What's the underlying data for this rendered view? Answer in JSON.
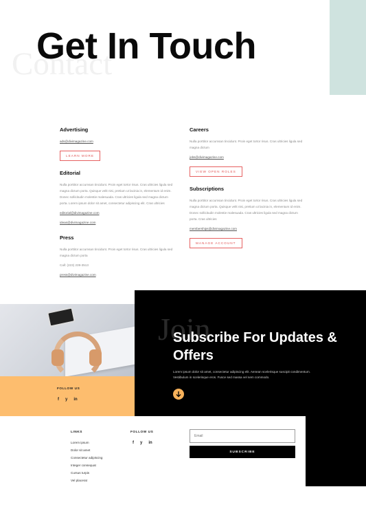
{
  "hero": {
    "title": "Get In Touch",
    "bg_word": "Contact"
  },
  "contact": {
    "advertising": {
      "heading": "Advertising",
      "email": "ads@divimagazine.com",
      "button": "LEARN MORE"
    },
    "editorial": {
      "heading": "Editorial",
      "text": "Nulla porttitor accumsan tincidunt. Proin eget tortor risus. Cras ultricies ligula sed magna dictum porta. Quisque velit nisi, pretium ut lacinia in, elementum id enim. Donec sollicitudin molestie malesuada. Cras ultricies ligula sed magna dictum porta. Lorem ipsum dolor sit amet, consectetur adipiscing elit. Cras ultricies",
      "email1": "editorial@divimagazine.com",
      "email2": "ideas@divimagazine.com"
    },
    "press": {
      "heading": "Press",
      "text": "Nulla porttitor accumsan tincidunt. Proin eget tortor risus. Cras ultricies ligula sed magna dictum porta",
      "phone": "Call: (223) 239-3513",
      "email": "press@divimagazine.com"
    },
    "careers": {
      "heading": "Careers",
      "text": "Nulla porttitor accumsan tincidunt. Proin eget tortor risus. Cras ultricies ligula sed magna dictum",
      "email": "jobs@divimagazine.com",
      "button": "VIEW OPEN ROLES"
    },
    "subscriptions": {
      "heading": "Subscriptions",
      "text": "Nulla porttitor accumsan tincidunt. Proin eget tortor risus. Cras ultricies ligula sed magna dictum porta. Quisque velit nisi, pretium ut lacinia in, elementum id enim. Donec sollicitudin molestie malesuada. Cras ultricies ligula sed magna dictum porta. Cras ultricies",
      "email": "memberships@divimagazine.com",
      "button": "MANAGE ACCOUNT"
    }
  },
  "subscribe": {
    "bg_word": "Join",
    "title": "Subscribe For Updates & Offers",
    "text": "Lorem ipsum dolor sit amet, consectetur adipiscing elit. Aenean scelerisque suscipit condimentum. Vestibulum in scelerisque eros. Fusce sed massa vel sem commodo.",
    "arrow_icon": "arrow-down-circle-icon"
  },
  "follow": {
    "label": "FOLLOW US",
    "icons": [
      "facebook-icon",
      "twitter-icon",
      "linkedin-icon"
    ],
    "glyphs": [
      "f",
      "y",
      "in"
    ]
  },
  "footer": {
    "links_label": "LINKS",
    "links": [
      "Lorem ipsum",
      "Dolor sit amet",
      "Consectetur adipiscing",
      "Integer consequat",
      "Cursus turpis",
      "Vel placerat"
    ],
    "follow_label": "FOLLOW US",
    "email_placeholder": "Email",
    "subscribe_button": "SUBSCRIBE"
  },
  "colors": {
    "accent_teal": "#cfe3df",
    "accent_orange": "#fdbd6e",
    "button_red": "#e05050",
    "black": "#000000"
  }
}
